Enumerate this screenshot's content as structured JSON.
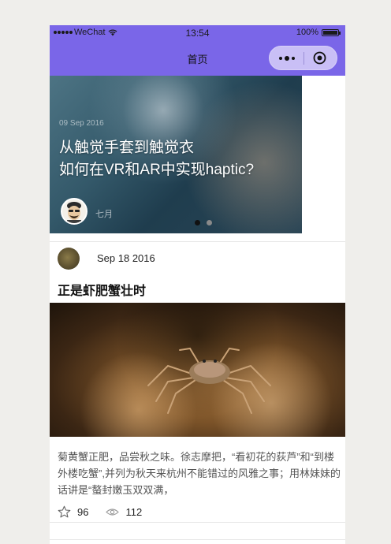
{
  "status_bar": {
    "carrier": "WeChat",
    "time": "13:54",
    "battery": "100%"
  },
  "nav": {
    "title": "首页",
    "more_icon": "more-dots-icon",
    "close_icon": "target-circle-icon"
  },
  "banner": {
    "date": "09 Sep 2016",
    "title_line1": "从触觉手套到触觉衣",
    "title_line2": "如何在VR和AR中实现haptic?",
    "author": "七月",
    "slide_count": 2,
    "active_slide": 1
  },
  "post": {
    "date": "Sep 18 2016",
    "title": "正是虾肥蟹壮时",
    "content": "菊黄蟹正肥，品尝秋之味。徐志摩把，“看初花的荻芦”和“到楼外楼吃蟹”,并列为秋天来杭州不能错过的风雅之事；用林妹妹的话讲是“螯封嫩玉双双满，",
    "stars": "96",
    "views": "112"
  },
  "colors": {
    "nav_bg": "#7a66e8",
    "page_bg": "#efeeeb"
  }
}
